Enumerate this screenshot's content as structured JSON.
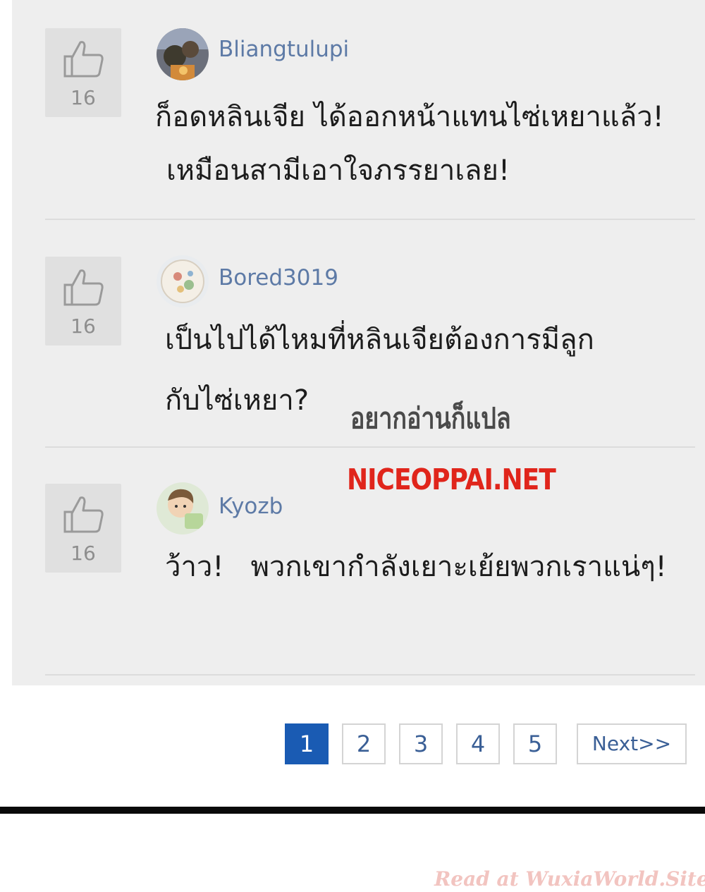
{
  "comments": [
    {
      "username": "Bliangtulupi",
      "likes": "16",
      "line1": "ก็อดหลินเจีย ได้ออกหน้าแทนไซ่เหยาแล้ว!",
      "line2": "เหมือนสามีเอาใจภรรยาเลย!"
    },
    {
      "username": "Bored3019",
      "likes": "16",
      "line1": "เป็นไปได้ไหมที่หลินเจียต้องการมีลูก",
      "line2": "กับไซ่เหยา?"
    },
    {
      "username": "Kyozb",
      "likes": "16",
      "line1": "ว้าว!   พวกเขากำลังเยาะเย้ยพวกเราแน่ๆ!"
    }
  ],
  "watermarks": {
    "thai": "อยากอ่านก็แปล",
    "site": "NICEOPPAI.NET",
    "footer": "Read at WuxiaWorld.Site"
  },
  "pagination": {
    "pages": [
      "1",
      "2",
      "3",
      "4",
      "5"
    ],
    "current": "1",
    "next_label": "Next>>"
  },
  "colors": {
    "username": "#5d7aa6",
    "active_page": "#1a5bb3",
    "watermark_red": "#e0251b"
  },
  "icons": {
    "like": "thumbs-up-icon"
  }
}
